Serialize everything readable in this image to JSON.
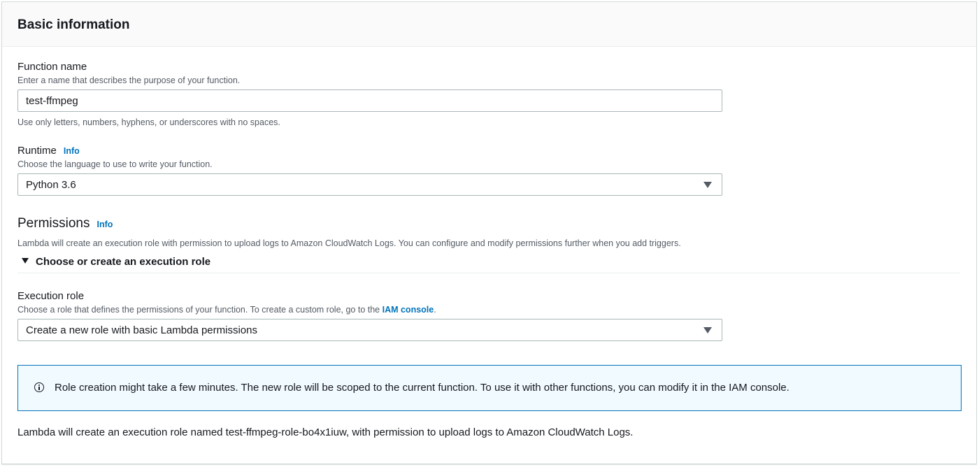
{
  "panel": {
    "title": "Basic information"
  },
  "function_name": {
    "label": "Function name",
    "description": "Enter a name that describes the purpose of your function.",
    "value": "test-ffmpeg",
    "constraint": "Use only letters, numbers, hyphens, or underscores with no spaces."
  },
  "runtime": {
    "label": "Runtime",
    "info": "Info",
    "description": "Choose the language to use to write your function.",
    "selected": "Python 3.6"
  },
  "permissions": {
    "title": "Permissions",
    "info": "Info",
    "description": "Lambda will create an execution role with permission to upload logs to Amazon CloudWatch Logs. You can configure and modify permissions further when you add triggers.",
    "expander_label": "Choose or create an execution role"
  },
  "execution_role": {
    "label": "Execution role",
    "description_prefix": "Choose a role that defines the permissions of your function. To create a custom role, go to the ",
    "description_link": "IAM console",
    "description_suffix": ".",
    "selected": "Create a new role with basic Lambda permissions"
  },
  "alert": {
    "text": "Role creation might take a few minutes. The new role will be scoped to the current function. To use it with other functions, you can modify it in the IAM console."
  },
  "footer_note": "Lambda will create an execution role named test-ffmpeg-role-bo4x1iuw, with permission to upload logs to Amazon CloudWatch Logs.",
  "colors": {
    "link": "#0073bb",
    "alert_border": "#0073bb",
    "alert_background": "#f1faff",
    "header_background": "#fafafa"
  },
  "icons": {
    "runtime_select": "caret-down-icon",
    "execution_role_select": "caret-down-icon",
    "expander": "caret-down-icon",
    "alert": "info-circle-icon"
  }
}
